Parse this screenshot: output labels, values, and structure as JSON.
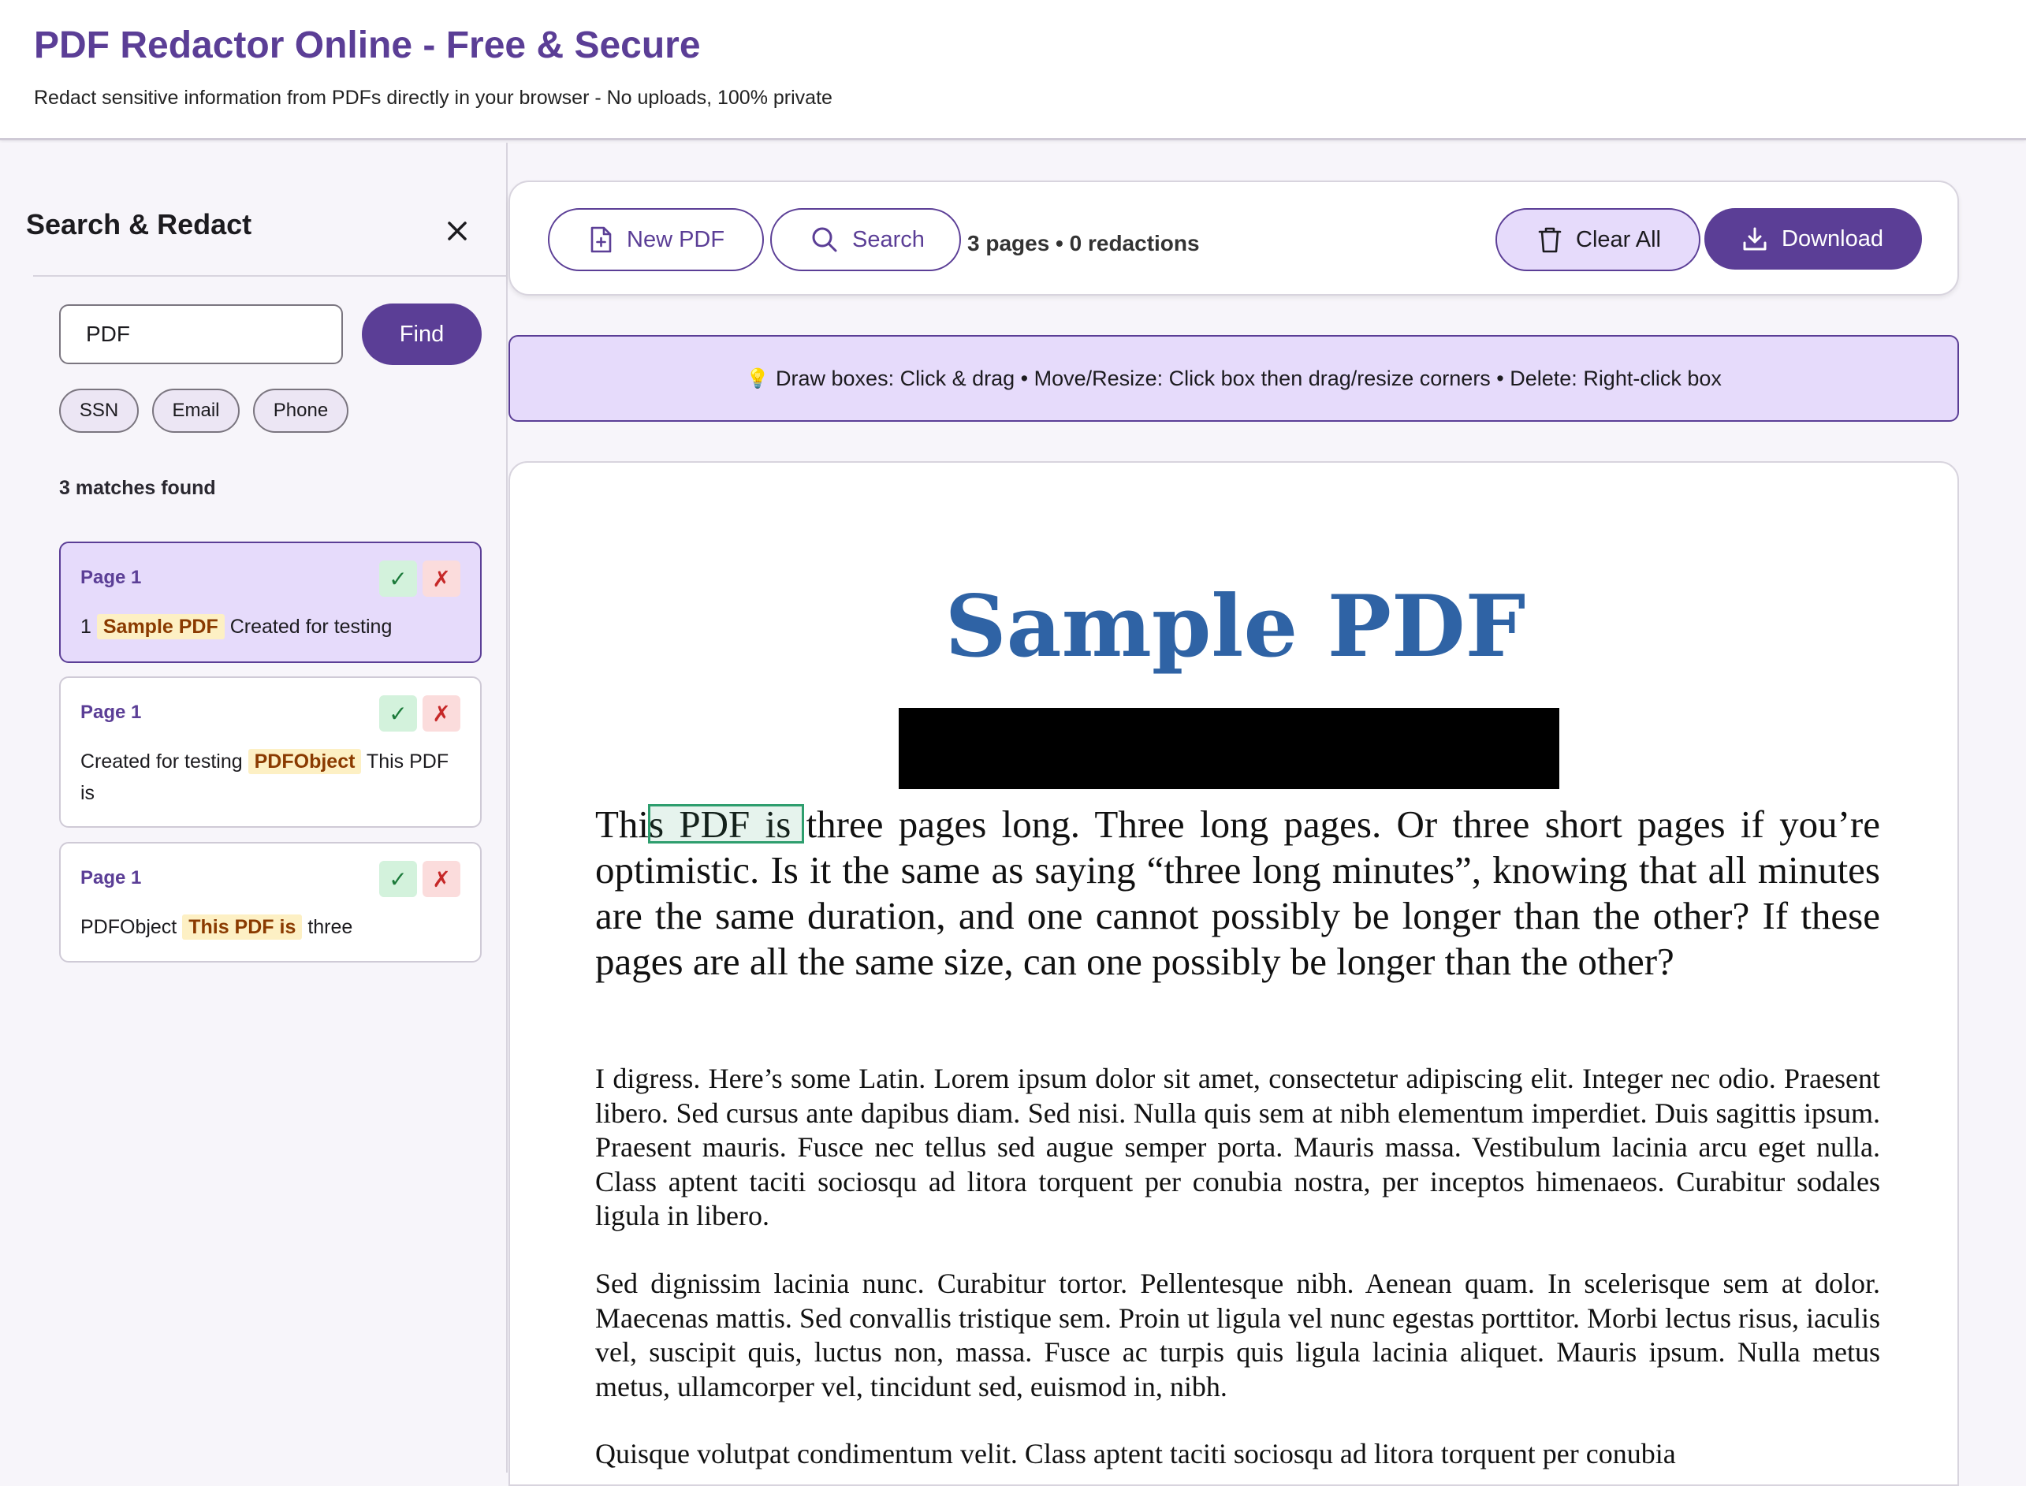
{
  "header": {
    "title": "PDF Redactor Online - Free & Secure",
    "subtitle": "Redact sensitive information from PDFs directly in your browser - No uploads, 100% private"
  },
  "sidebar": {
    "title": "Search & Redact",
    "close_icon": "close-icon",
    "search": {
      "value": "PDF",
      "placeholder": ""
    },
    "find_label": "Find",
    "presets": [
      "SSN",
      "Email",
      "Phone"
    ],
    "matches_label": "3 matches found",
    "matches": [
      {
        "page": "Page 1",
        "before": "1",
        "match": "Sample PDF",
        "after": "Created for testing",
        "active": true
      },
      {
        "page": "Page 1",
        "before": "Created for testing",
        "match": "PDFObject",
        "after": "This PDF is",
        "active": false
      },
      {
        "page": "Page 1",
        "before": "PDFObject",
        "match": "This PDF is",
        "after": "three",
        "active": false
      }
    ],
    "accept_glyph": "✓",
    "reject_glyph": "✗"
  },
  "toolbar": {
    "new_pdf_label": "New PDF",
    "search_label": "Search",
    "status": "3 pages • 0 redactions",
    "clear_label": "Clear All",
    "download_label": "Download"
  },
  "hint": {
    "icon": "lightbulb-icon",
    "text": "Draw boxes: Click & drag • Move/Resize: Click box then drag/resize corners • Delete: Right-click box"
  },
  "document": {
    "title": "Sample PDF",
    "lead": "This PDF is three pages long. Three long pages. Or three short pages if you’re optimistic. Is it the same as saying “three long minutes”, knowing that all minutes are the same duration, and one cannot possibly be longer than the other? If these pages are all the same size, can one possibly be longer than the other?",
    "paragraphs": [
      "I digress. Here’s some Latin. Lorem ipsum dolor sit amet, consectetur adipiscing elit. Integer nec odio. Praesent libero. Sed cursus ante dapibus diam. Sed nisi. Nulla quis sem at nibh elementum imperdiet. Duis sagittis ipsum. Praesent mauris. Fusce nec tellus sed augue semper porta. Mauris massa. Vestibulum lacinia arcu eget nulla. Class aptent taciti sociosqu ad litora torquent per conubia nostra, per inceptos himenaeos. Curabitur sodales ligula in libero.",
      "Sed dignissim lacinia nunc. Curabitur tortor. Pellentesque nibh. Aenean quam. In scelerisque sem at dolor. Maecenas mattis. Sed convallis tristique sem. Proin ut ligula vel nunc egestas porttitor. Morbi lectus risus, iaculis vel, suscipit quis, luctus non, massa. Fusce ac turpis quis ligula lacinia aliquet. Mauris ipsum. Nulla metus metus, ullamcorper vel, tincidunt sed, euismod in, nibh.",
      "Quisque volutpat condimentum velit. Class aptent taciti sociosqu ad litora torquent per conubia"
    ]
  },
  "colors": {
    "brand": "#5b3e96",
    "accent_light": "#e6dbfb",
    "pdf_title": "#2f63a5",
    "match_highlight": "#fdf0c4"
  }
}
